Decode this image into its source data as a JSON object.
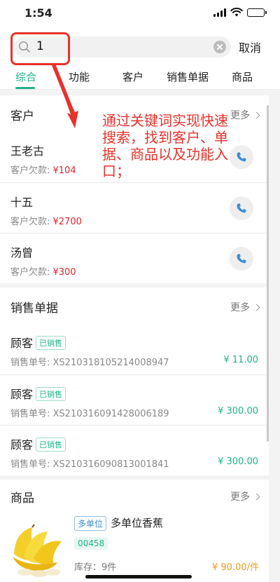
{
  "status_bar": {
    "time": "1:54"
  },
  "search": {
    "value": "1",
    "cancel_label": "取消"
  },
  "tabs": [
    {
      "label": "综合",
      "active": true
    },
    {
      "label": "功能"
    },
    {
      "label": "客户"
    },
    {
      "label": "销售单据"
    },
    {
      "label": "商品"
    }
  ],
  "customers": {
    "title": "客户",
    "more_label": "更多",
    "debt_label": "客户欠款: ",
    "items": [
      {
        "name": "王老古",
        "debt": "¥104"
      },
      {
        "name": "十五",
        "debt": "¥2700"
      },
      {
        "name": "汤曾",
        "debt": "¥300"
      }
    ]
  },
  "sales_orders": {
    "title": "销售单据",
    "more_label": "更多",
    "number_label": "销售单号: ",
    "items": [
      {
        "name": "顾客",
        "tag": "已销售",
        "number": "XS210318105214008947",
        "amount": "¥ 11.00"
      },
      {
        "name": "顾客",
        "tag": "已销售",
        "number": "XS210316091428006189",
        "amount": "¥ 300.00"
      },
      {
        "name": "顾客",
        "tag": "已销售",
        "number": "XS210316090813001841",
        "amount": "¥ 300.00"
      }
    ]
  },
  "products": {
    "title": "商品",
    "more_label": "更多",
    "items": [
      {
        "unit_tag": "多单位",
        "name": "多单位香蕉",
        "code": "00458",
        "stock": "库存：9件",
        "price": "¥ 90.00/件"
      }
    ]
  },
  "annotation": {
    "text": "通过关键词实现快速搜索，找到客户、单据、商品以及功能入口；"
  },
  "colors": {
    "accent": "#1fb48a",
    "debt_red": "#e0252f",
    "price_orange": "#f39a1e",
    "annotation_red": "#e7322b"
  },
  "icons": [
    "search-icon",
    "clear-icon",
    "phone-icon",
    "chevron-right-icon",
    "banana-image"
  ]
}
